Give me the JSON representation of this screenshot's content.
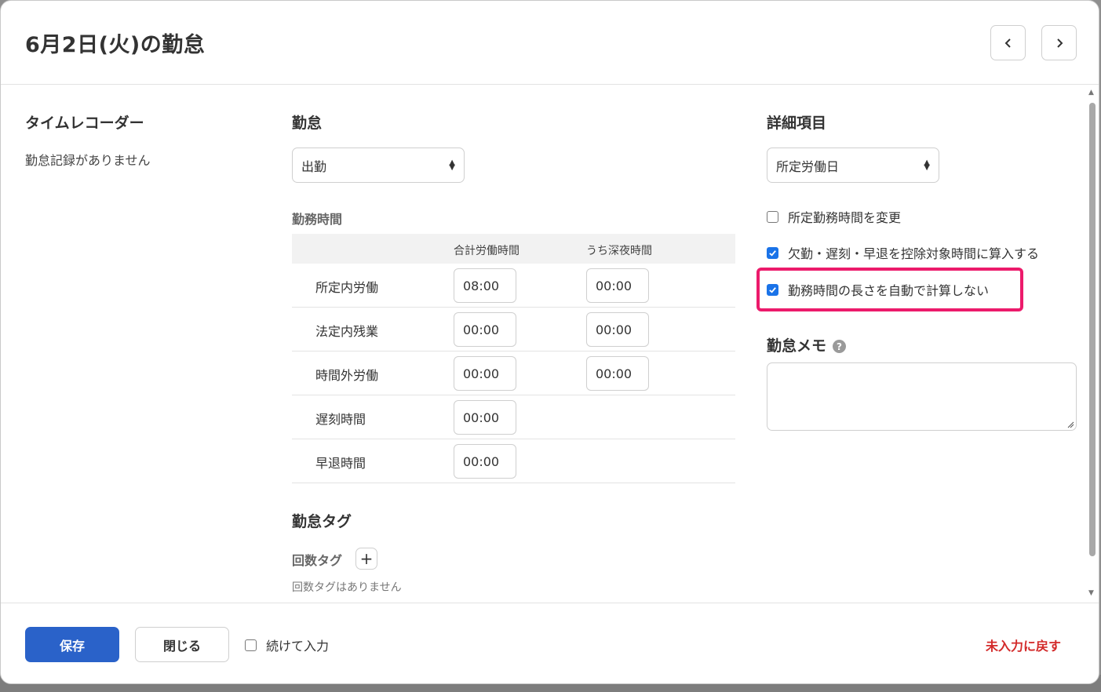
{
  "header": {
    "title": "6月2日(火)の勤怠"
  },
  "timerecorder": {
    "title": "タイムレコーダー",
    "empty_text": "勤怠記録がありません"
  },
  "attendance": {
    "title": "勤怠",
    "select_value": "出勤",
    "work_time_title": "勤務時間",
    "columns": [
      "合計労働時間",
      "うち深夜時間"
    ],
    "rows": [
      {
        "label": "所定内労働",
        "total": "08:00",
        "night": "00:00"
      },
      {
        "label": "法定内残業",
        "total": "00:00",
        "night": "00:00"
      },
      {
        "label": "時間外労働",
        "total": "00:00",
        "night": "00:00"
      },
      {
        "label": "遅刻時間",
        "total": "00:00",
        "night": null
      },
      {
        "label": "早退時間",
        "total": "00:00",
        "night": null
      }
    ],
    "tag_title": "勤怠タグ",
    "count_tag_label": "回数タグ",
    "count_tag_add": "+",
    "count_tag_empty": "回数タグはありません"
  },
  "details": {
    "title": "詳細項目",
    "select_value": "所定労働日",
    "checkboxes": [
      {
        "label": "所定勤務時間を変更",
        "checked": false
      },
      {
        "label": "欠勤・遅刻・早退を控除対象時間に算入する",
        "checked": true
      },
      {
        "label": "勤務時間の長さを自動で計算しない",
        "checked": true
      }
    ],
    "memo_title": "勤怠メモ",
    "help_glyph": "?",
    "memo_value": ""
  },
  "footer": {
    "save_label": "保存",
    "close_label": "閉じる",
    "continue_label": "続けて入力",
    "continue_checked": false,
    "reset_label": "未入力に戻す"
  },
  "colors": {
    "primary": "#2a62c9",
    "checkbox": "#1a73e8",
    "highlight": "#ec1a6b",
    "danger": "#d32a2a"
  }
}
